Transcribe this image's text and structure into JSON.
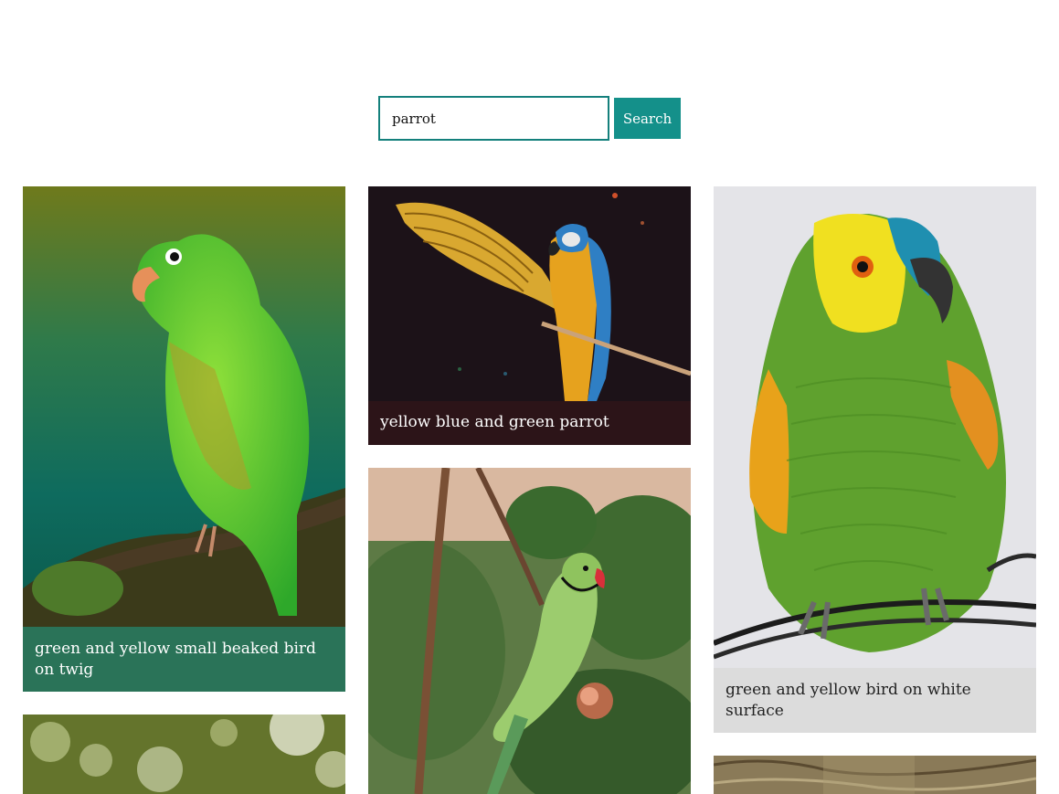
{
  "search": {
    "value": "parrot",
    "button_label": "Search"
  },
  "results": [
    {
      "caption": "green and yellow small beaked bird on twig",
      "caption_color": "#2a7358"
    },
    {
      "caption": "yellow blue and green parrot",
      "caption_color": "#2c1418"
    },
    {
      "caption": "",
      "caption_color": ""
    },
    {
      "caption": "green and yellow bird on white surface",
      "caption_color": "#dcdcdc"
    },
    {
      "caption": "",
      "caption_color": ""
    },
    {
      "caption": "",
      "caption_color": ""
    }
  ],
  "colors": {
    "accent": "#14908a",
    "input_border": "#14807c"
  }
}
